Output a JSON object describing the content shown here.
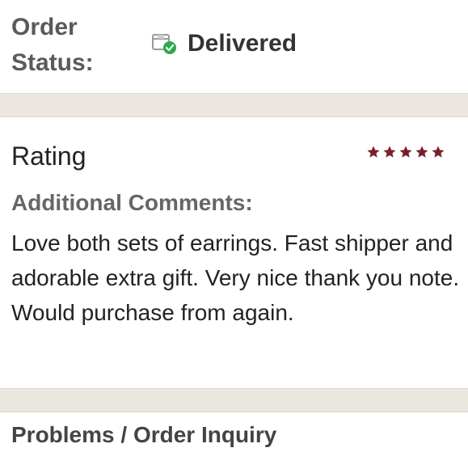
{
  "order_status": {
    "label": "Order Status:",
    "value": "Delivered",
    "icon": "delivered-box-icon",
    "check_color": "#2ea84a"
  },
  "rating": {
    "label": "Rating",
    "stars": 5,
    "max_stars": 5,
    "star_color": "#7a1f2b"
  },
  "comments": {
    "label": "Additional Comments:",
    "text": "Love both sets of earrings. Fast shipper and adorable extra gift. Very nice thank you note. Would purchase from again."
  },
  "problems": {
    "label": "Problems / Order Inquiry"
  }
}
